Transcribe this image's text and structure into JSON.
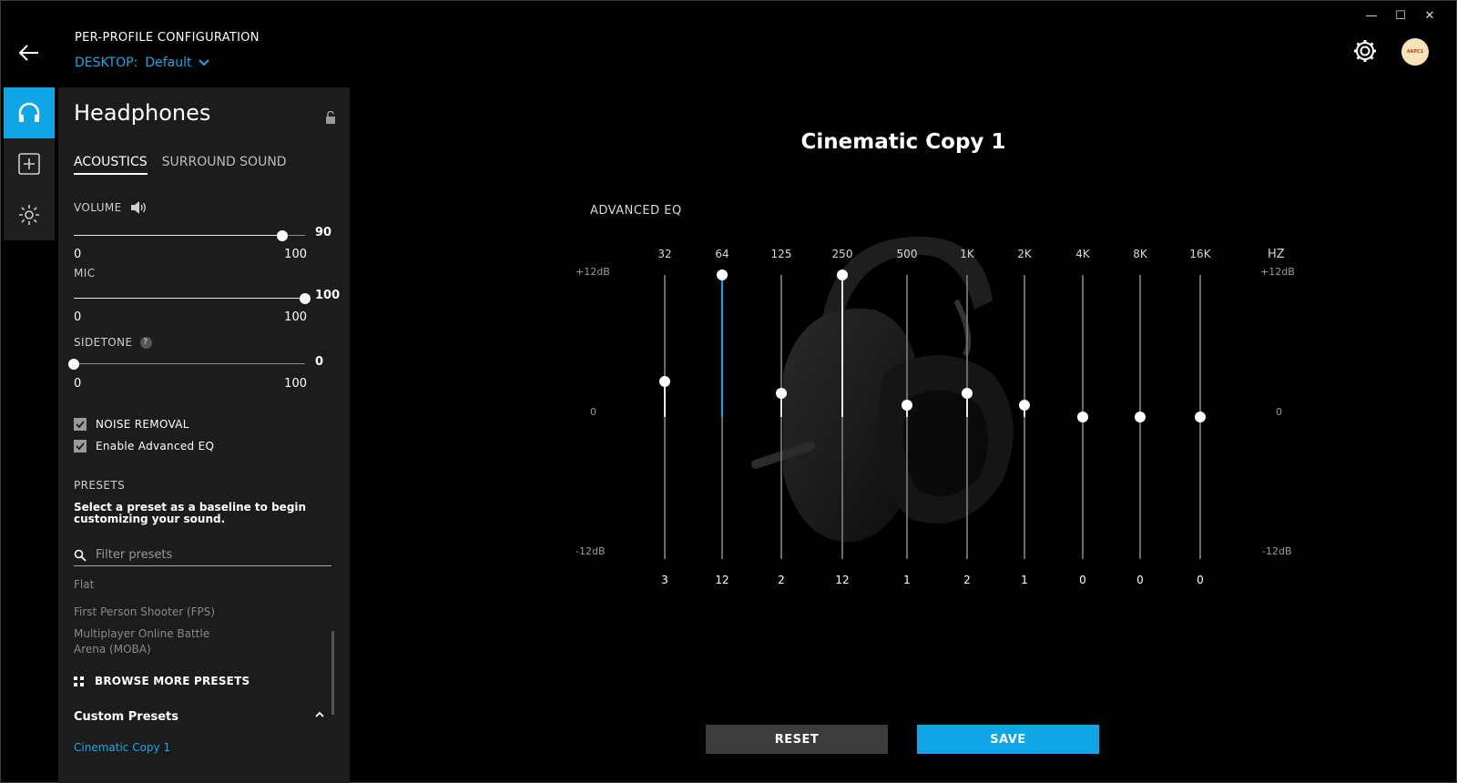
{
  "window": {
    "minimize": "—",
    "maximize": "☐",
    "close": "✕"
  },
  "header": {
    "config_title": "PER-PROFILE CONFIGURATION",
    "profile_prefix": "DESKTOP:",
    "profile_name": "Default",
    "avatar_text": "4APC1"
  },
  "rail": {
    "items": [
      "headphones-icon",
      "add-icon",
      "lighting-icon"
    ],
    "active": 0
  },
  "panel": {
    "title": "Headphones",
    "tabs": [
      {
        "label": "ACOUSTICS",
        "active": true
      },
      {
        "label": "SURROUND SOUND",
        "active": false
      }
    ],
    "volume": {
      "label": "VOLUME",
      "value": "90",
      "min": "0",
      "max": "100",
      "level": 0.9
    },
    "mic": {
      "label": "MIC",
      "value": "100",
      "min": "0",
      "max": "100",
      "level": 1.0
    },
    "sidetone": {
      "label": "SIDETONE",
      "help": "?",
      "value": "0",
      "min": "0",
      "max": "100",
      "level": 0
    },
    "noise_removal": {
      "label": "NOISE REMOVAL",
      "checked": true
    },
    "advanced_eq": {
      "label": "Enable Advanced EQ",
      "checked": true
    },
    "presets": {
      "heading": "PRESETS",
      "description": "Select a preset as a baseline to begin customizing your sound.",
      "filter_placeholder": "Filter presets",
      "items": [
        "Flat",
        "First Person Shooter (FPS)",
        "Multiplayer Online Battle Arena (MOBA)"
      ],
      "browse_label": "BROWSE MORE PRESETS",
      "custom_heading": "Custom Presets",
      "custom_items": [
        "Cinematic Copy 1"
      ]
    }
  },
  "main": {
    "preset_title": "Cinematic Copy 1",
    "advanced_eq_label": "ADVANCED EQ",
    "hz_label": "HZ",
    "db_top": "+12dB",
    "db_mid": "0",
    "db_bottom": "-12dB",
    "reset_label": "RESET",
    "save_label": "SAVE"
  },
  "eq_bands": [
    {
      "freq": "32",
      "value": "3",
      "gain": 3,
      "highlight": false
    },
    {
      "freq": "64",
      "value": "12",
      "gain": 12,
      "highlight": true
    },
    {
      "freq": "125",
      "value": "2",
      "gain": 2,
      "highlight": false
    },
    {
      "freq": "250",
      "value": "12",
      "gain": 12,
      "highlight": false
    },
    {
      "freq": "500",
      "value": "1",
      "gain": 1,
      "highlight": false
    },
    {
      "freq": "1K",
      "value": "2",
      "gain": 2,
      "highlight": false
    },
    {
      "freq": "2K",
      "value": "1",
      "gain": 1,
      "highlight": false
    },
    {
      "freq": "4K",
      "value": "0",
      "gain": 0,
      "highlight": false
    },
    {
      "freq": "8K",
      "value": "0",
      "gain": 0,
      "highlight": false
    },
    {
      "freq": "16K",
      "value": "0",
      "gain": 0,
      "highlight": false
    }
  ],
  "colors": {
    "accent": "#10a6e6",
    "panel": "#1c1c1c",
    "background": "#000000"
  }
}
